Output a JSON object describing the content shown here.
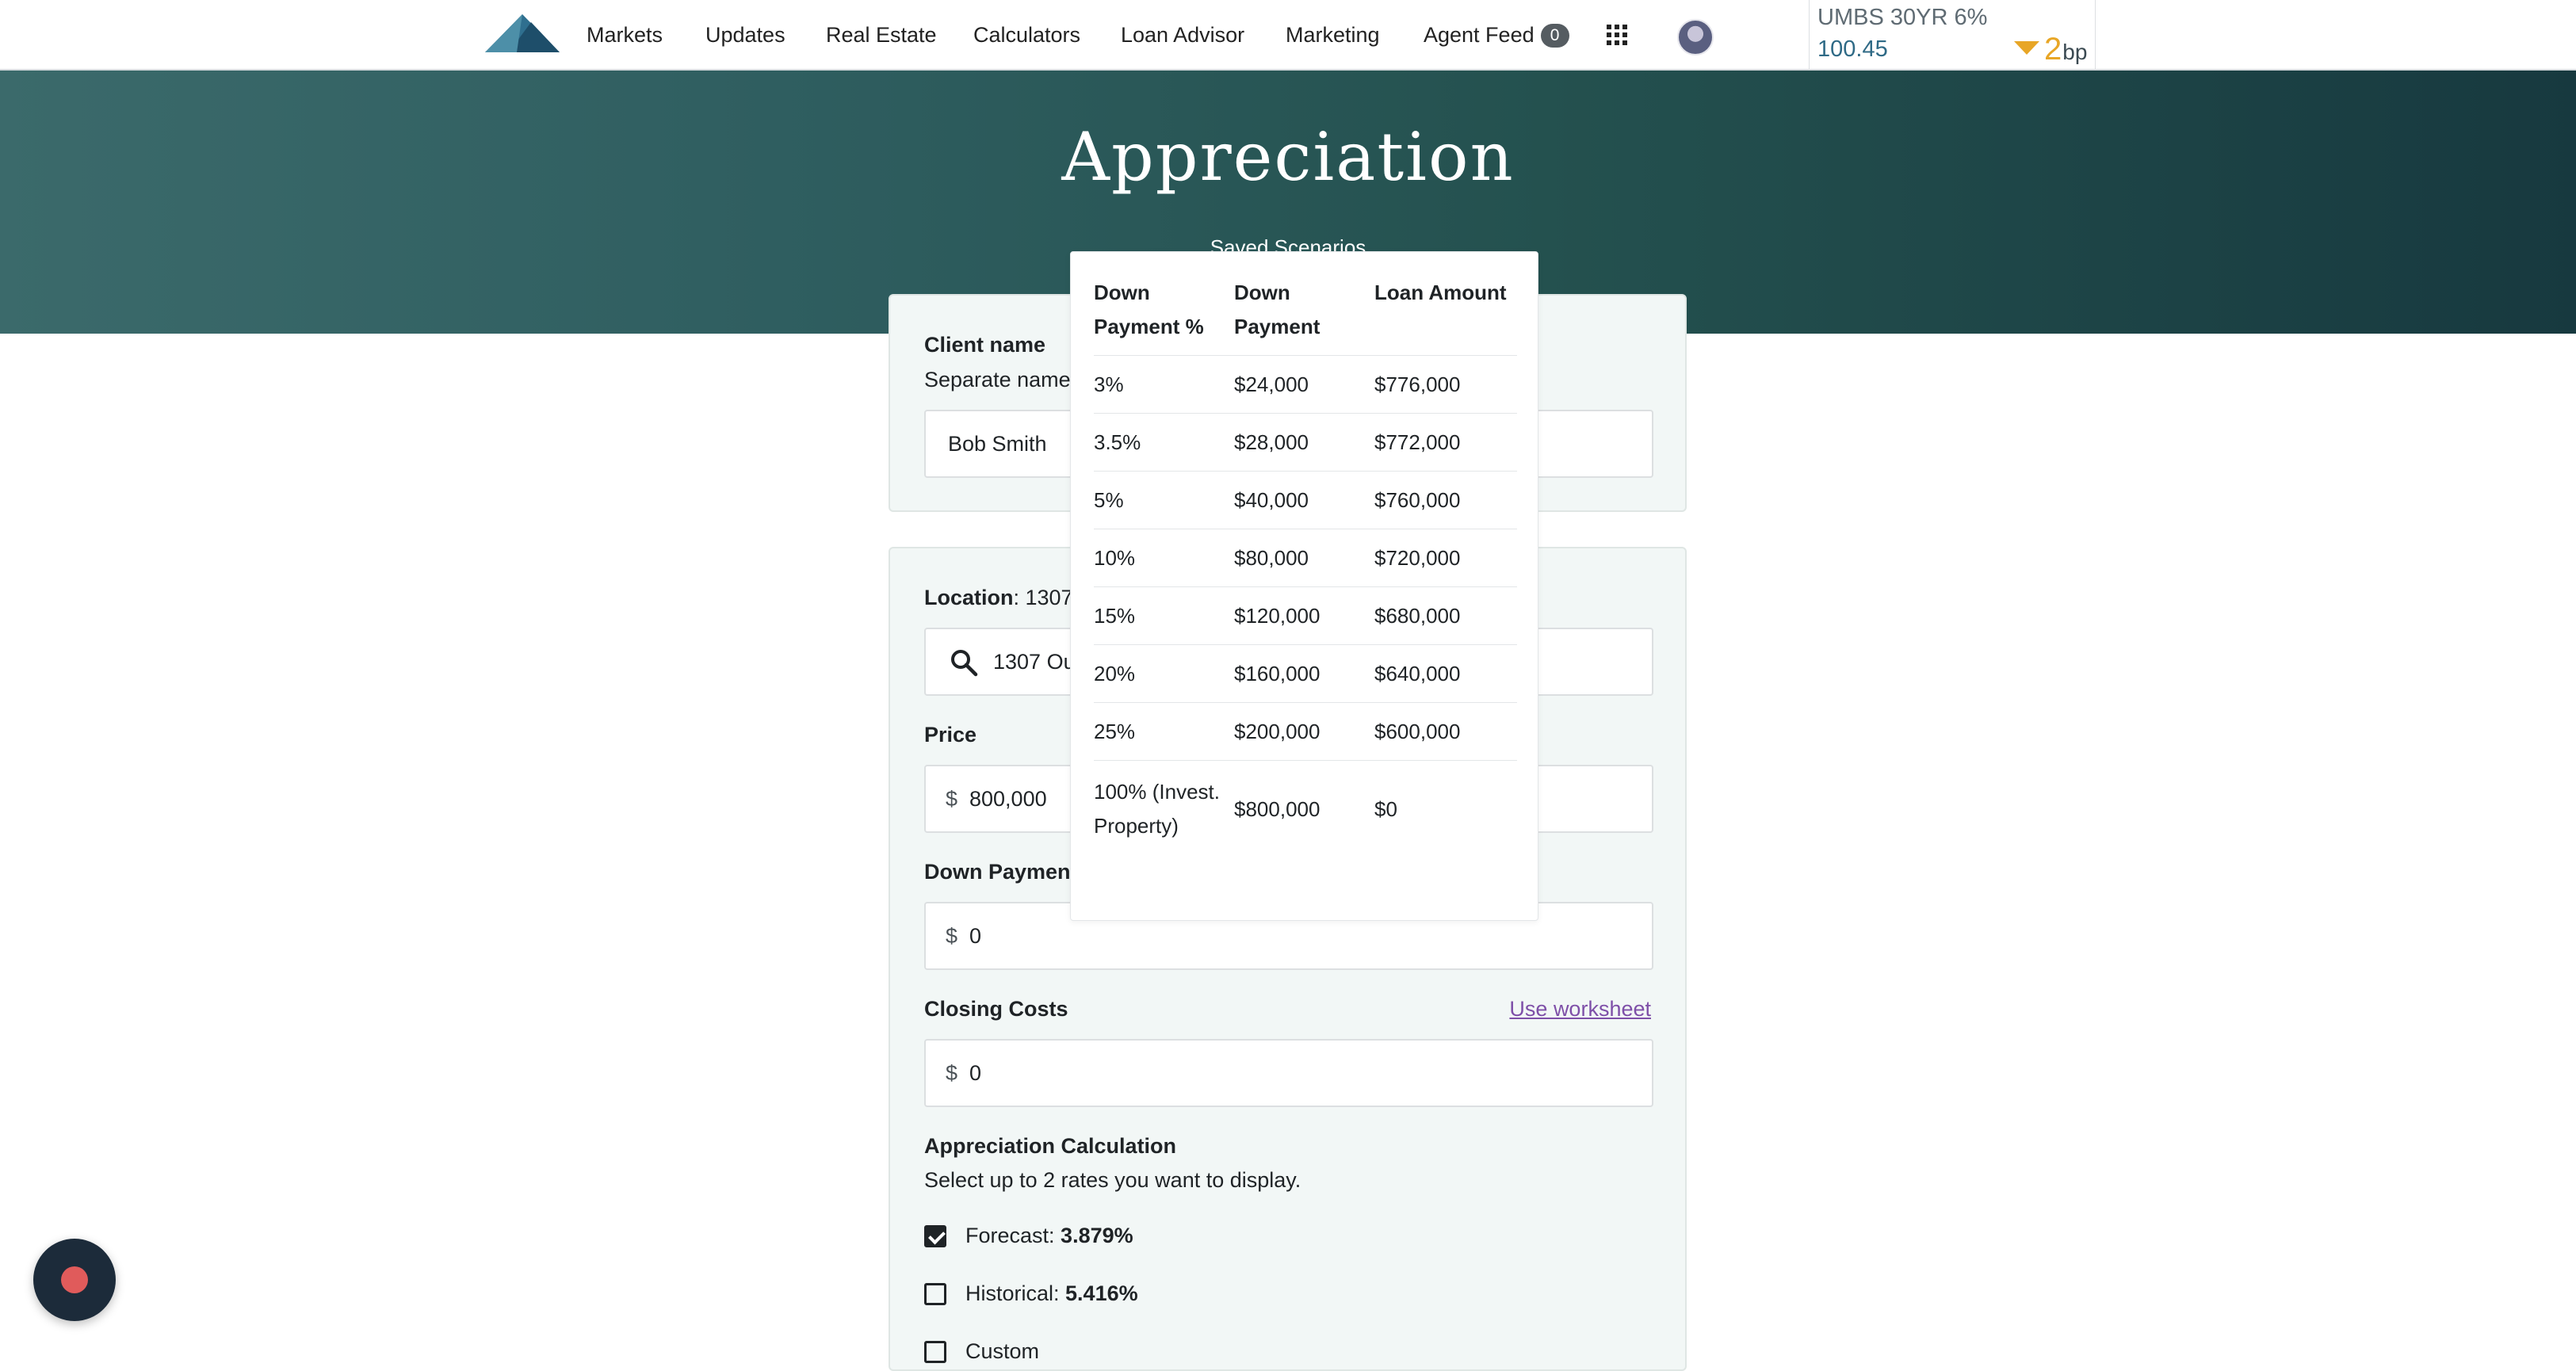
{
  "nav": {
    "items": [
      "Markets",
      "Updates",
      "Real Estate",
      "Calculators",
      "Loan Advisor",
      "Marketing",
      "Agent Feed"
    ],
    "agent_feed_count": "0",
    "logo_icon": "mountain-logo",
    "apps_icon": "grid-icon",
    "avatar_icon": "user-avatar"
  },
  "ticker": {
    "name": "UMBS 30YR 6%",
    "price": "100.45",
    "change": "2",
    "unit": "bp",
    "direction": "down",
    "color": "#e8a626"
  },
  "hero": {
    "title": "Appreciation",
    "subtitle": "Saved Scenarios"
  },
  "client": {
    "label": "Client name",
    "helper": "Separate name",
    "value": "Bob Smith"
  },
  "location": {
    "label": "Location",
    "summary": ": 1307",
    "value": "1307 Ou",
    "icon": "search-icon"
  },
  "price": {
    "label": "Price",
    "currency": "$",
    "value": "800,000"
  },
  "down_payment": {
    "label": "Down Payment",
    "currency": "$",
    "value": "0"
  },
  "closing_costs": {
    "label": "Closing Costs",
    "currency": "$",
    "value": "0",
    "link": "Use worksheet"
  },
  "appreciation": {
    "label": "Appreciation Calculation",
    "helper": "Select up to 2 rates you want to display.",
    "options": [
      {
        "label": "Forecast: ",
        "value": "3.879%",
        "checked": true
      },
      {
        "label": "Historical: ",
        "value": "5.416%",
        "checked": false
      },
      {
        "label": "Custom",
        "value": "",
        "checked": false
      }
    ]
  },
  "popup": {
    "headers": [
      "Down Payment %",
      "Down Payment",
      "Loan Amount"
    ],
    "rows": [
      [
        "3%",
        "$24,000",
        "$776,000"
      ],
      [
        "3.5%",
        "$28,000",
        "$772,000"
      ],
      [
        "5%",
        "$40,000",
        "$760,000"
      ],
      [
        "10%",
        "$80,000",
        "$720,000"
      ],
      [
        "15%",
        "$120,000",
        "$680,000"
      ],
      [
        "20%",
        "$160,000",
        "$640,000"
      ],
      [
        "25%",
        "$200,000",
        "$600,000"
      ],
      [
        "100% (Invest. Property)",
        "$800,000",
        "$0"
      ]
    ]
  },
  "colors": {
    "hero_start": "#3b6a6b",
    "hero_end": "#17393f",
    "link": "#7e4fa8",
    "chat_button": "#1c2b3a",
    "chat_dot": "#e05b5b"
  }
}
